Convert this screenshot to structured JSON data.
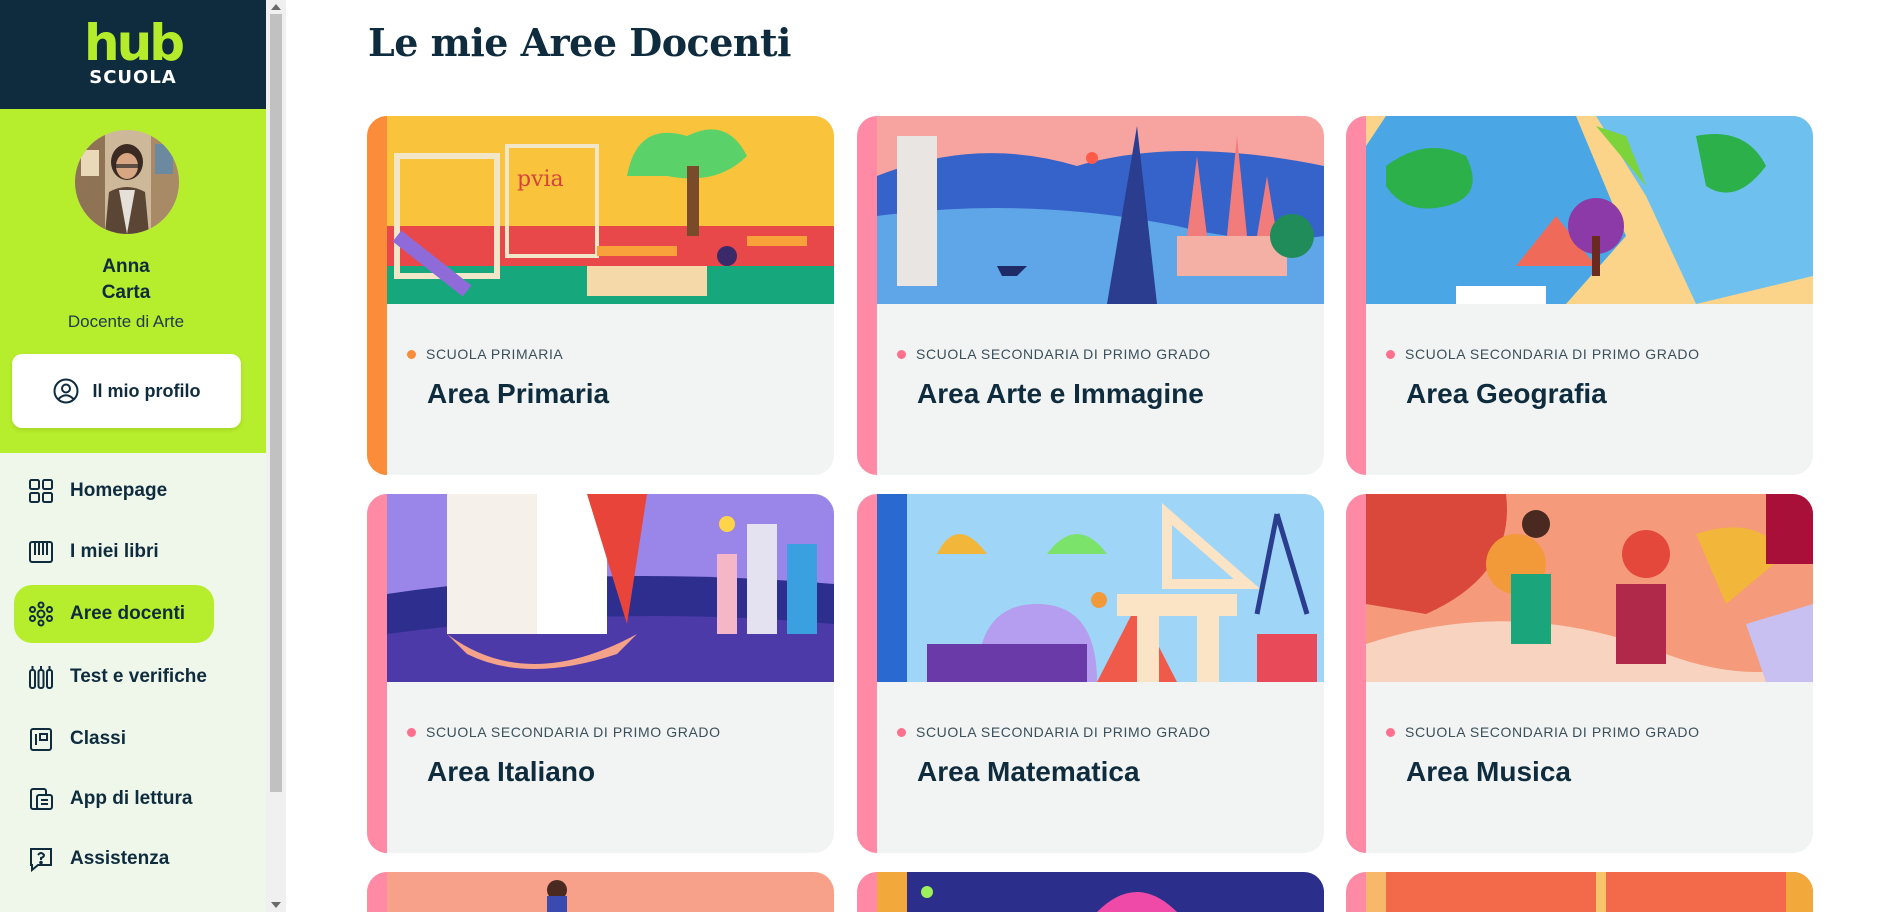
{
  "logo": {
    "brand": "hub",
    "sub": "SCUOLA"
  },
  "user": {
    "first_name": "Anna",
    "last_name": "Carta",
    "role": "Docente di Arte"
  },
  "profile_button": {
    "label": "Il mio profilo",
    "icon": "user-circle-icon"
  },
  "nav": [
    {
      "label": "Homepage",
      "icon": "grid-icon",
      "active": false
    },
    {
      "label": "I miei libri",
      "icon": "books-icon",
      "active": false
    },
    {
      "label": "Aree docenti",
      "icon": "areas-icon",
      "active": true
    },
    {
      "label": "Test e verifiche",
      "icon": "tests-icon",
      "active": false
    },
    {
      "label": "Classi",
      "icon": "class-icon",
      "active": false
    },
    {
      "label": "App di lettura",
      "icon": "reader-icon",
      "active": false
    },
    {
      "label": "Assistenza",
      "icon": "help-icon",
      "active": false
    }
  ],
  "page": {
    "title": "Le mie Aree Docenti"
  },
  "colors": {
    "primaria": "#fa8c3a",
    "secondaria": "#ff8aa5",
    "accent": "#b6ed2c",
    "navy": "#0f2c3e"
  },
  "cards": [
    {
      "level": "SCUOLA PRIMARIA",
      "title": "Area Primaria",
      "accent": "orange"
    },
    {
      "level": "SCUOLA SECONDARIA DI PRIMO GRADO",
      "title": "Area Arte e Immagine",
      "accent": "pink"
    },
    {
      "level": "SCUOLA SECONDARIA DI PRIMO GRADO",
      "title": "Area Geografia",
      "accent": "pink"
    },
    {
      "level": "SCUOLA SECONDARIA DI PRIMO GRADO",
      "title": "Area Italiano",
      "accent": "pink"
    },
    {
      "level": "SCUOLA SECONDARIA DI PRIMO GRADO",
      "title": "Area Matematica",
      "accent": "pink"
    },
    {
      "level": "SCUOLA SECONDARIA DI PRIMO GRADO",
      "title": "Area Musica",
      "accent": "pink"
    }
  ]
}
